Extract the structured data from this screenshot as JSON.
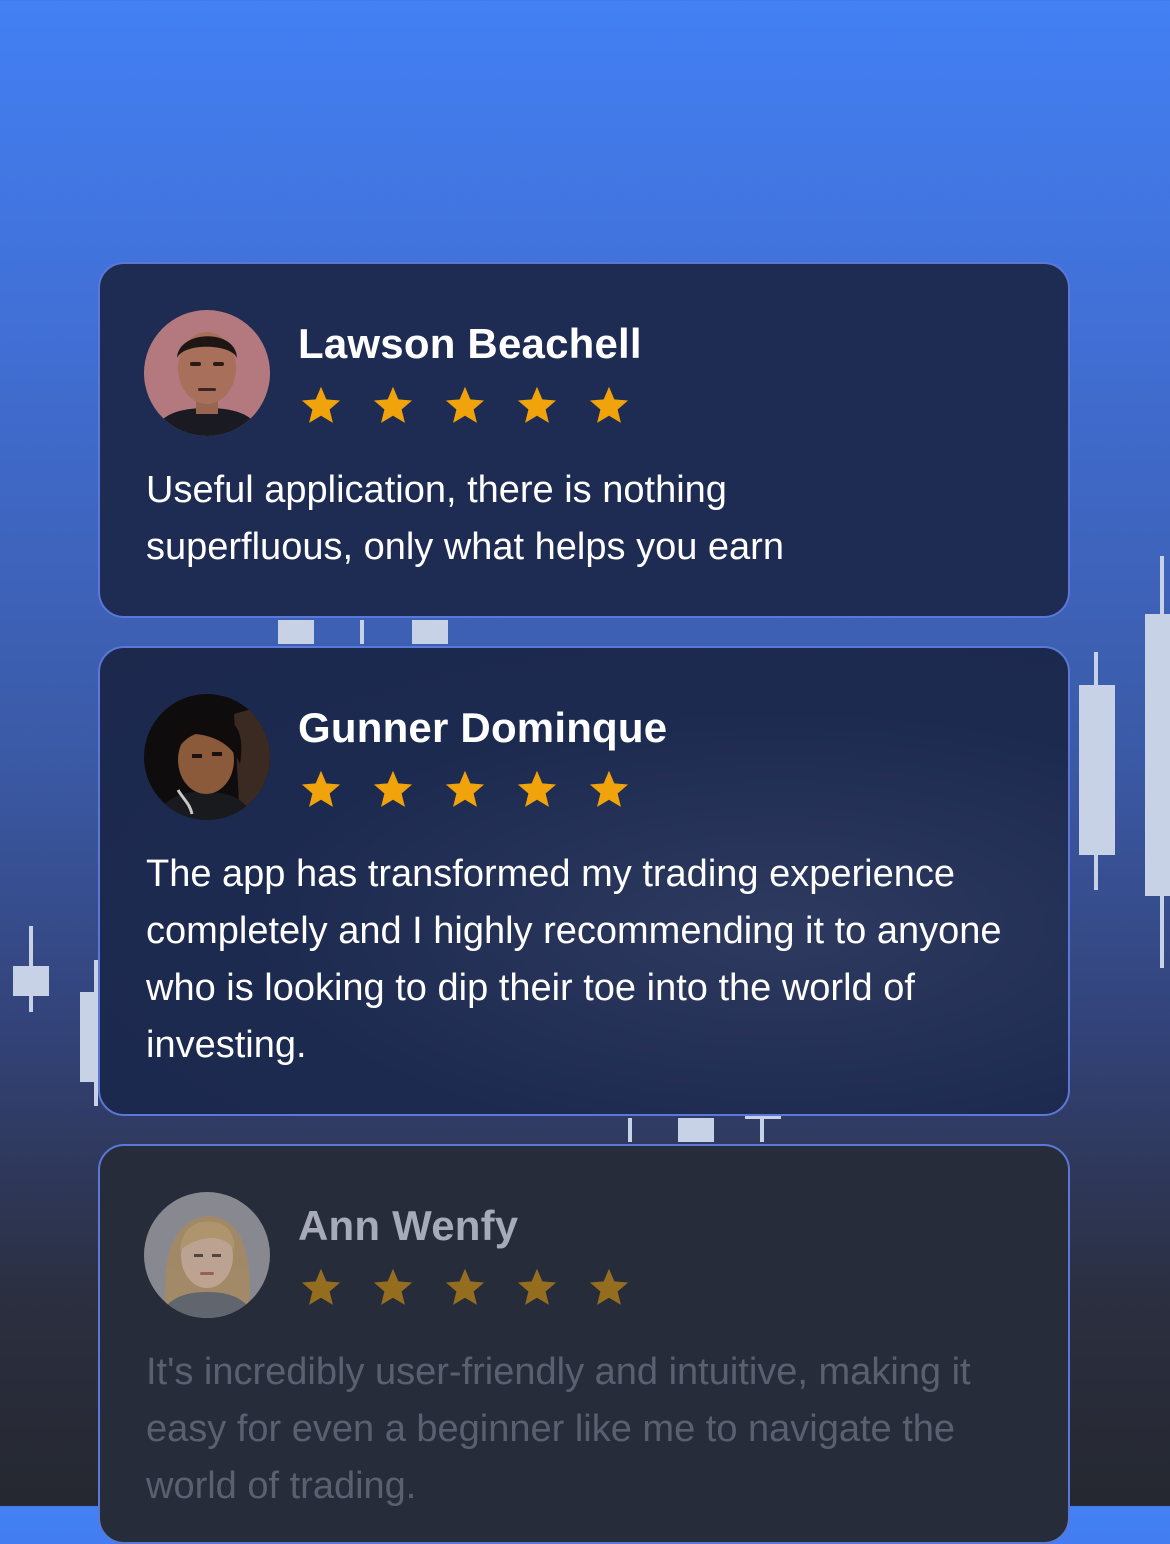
{
  "colors": {
    "star": "#f0a30a",
    "card_border": "#5b78d8",
    "card_bg": "#1e2b52",
    "text": "#ffffff"
  },
  "reviews": [
    {
      "name": "Lawson Beachell",
      "rating": 5,
      "text": "Useful application, there is nothing superfluous, only what helps you earn",
      "avatar": "man-portrait-photo"
    },
    {
      "name": "Gunner Dominque",
      "rating": 5,
      "text": "The app has transformed my trading experience completely and I highly recommending it to anyone who is looking to dip their toe into the world of investing.",
      "avatar": "young-man-dark-photo"
    },
    {
      "name": "Ann Wenfy",
      "rating": 5,
      "text": "It's incredibly user-friendly and intuitive, making it easy for even a beginner like me to navigate the world of trading.",
      "avatar": "woman-blonde-photo"
    }
  ]
}
